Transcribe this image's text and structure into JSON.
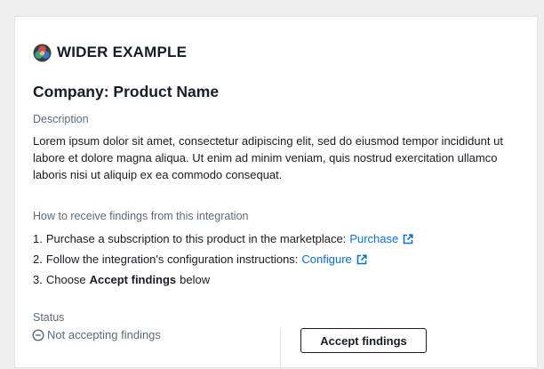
{
  "brand": {
    "name": "WIDER EXAMPLE",
    "logo_icon": "colorful-globe-logo"
  },
  "product": {
    "title": "Company: Product Name"
  },
  "description": {
    "label": "Description",
    "text": "Lorem ipsum dolor sit amet, consectetur adipiscing elit, sed do eiusmod tempor incididunt ut labore et dolore magna aliqua. Ut enim ad minim veniam, quis nostrud exercitation ullamco laboris nisi ut aliquip ex ea commodo consequat."
  },
  "instructions": {
    "label": "How to receive findings from this integration",
    "steps": [
      {
        "number": "1.",
        "text": "Purchase a subscription to this product in the marketplace:",
        "link": "Purchase"
      },
      {
        "number": "2.",
        "text": "Follow the integration's configuration instructions:",
        "link": "Configure"
      },
      {
        "number": "3.",
        "text_before": "Choose",
        "bold": "Accept findings",
        "text_after": "below"
      }
    ]
  },
  "status": {
    "label": "Status",
    "value": "Not accepting findings",
    "icon": "minus-circle-icon"
  },
  "actions": {
    "accept_label": "Accept findings"
  },
  "colors": {
    "link": "#0972d3",
    "text": "#161d26",
    "muted": "#5f6b7a",
    "background": "#eeeeee",
    "card": "#ffffff"
  }
}
